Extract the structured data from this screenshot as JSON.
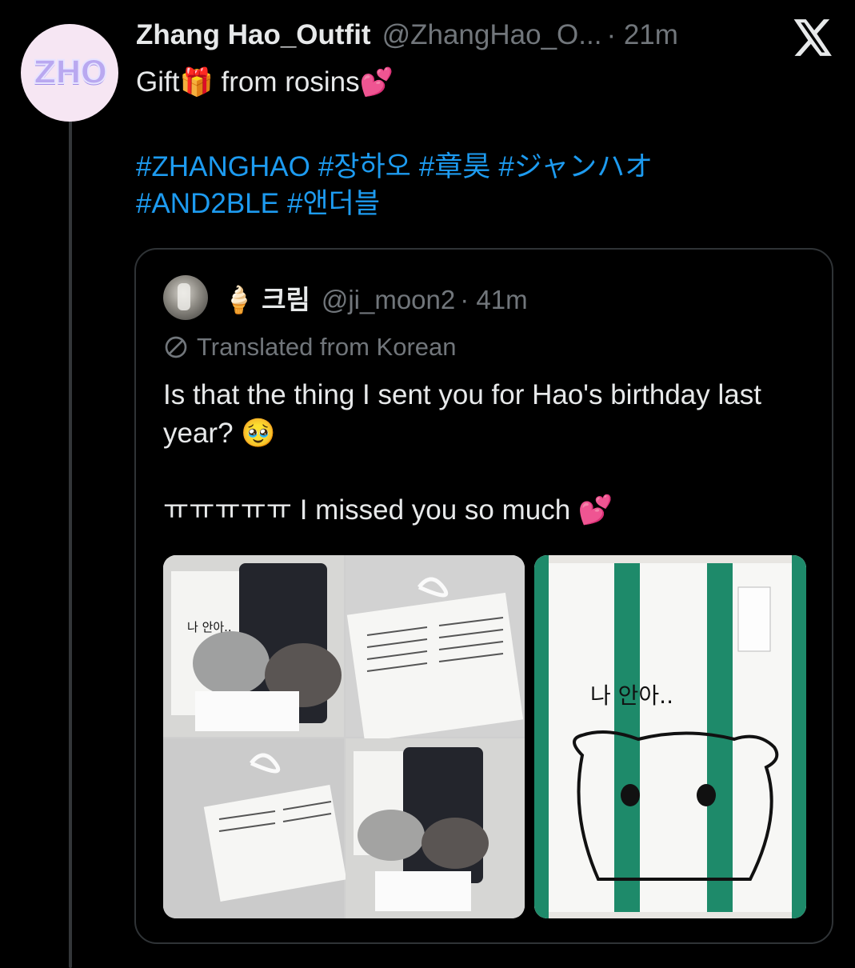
{
  "tweet": {
    "avatar_text": "ZHO",
    "display_name": "Zhang Hao_Outfit",
    "handle": "@ZhangHao_O...",
    "time": "· 21m",
    "text_before_emoji": "Gift",
    "gift_emoji": "🎁",
    "text_after_emoji": " from rosins",
    "heart_emoji": "💕",
    "hashtags": [
      "#ZHANGHAO",
      "#장하오",
      "#章昊",
      "#ジャンハオ",
      "#AND2BLE",
      "#앤더블"
    ]
  },
  "quote": {
    "name_emoji": "🍦",
    "display_name": "크림",
    "handle": "@ji_moon2",
    "time": "· 41m",
    "translated_label": "Translated from Korean",
    "text_line1": "Is that the thing I sent you for Hao's birthday last year? 🥹",
    "text_line2": "ㅠㅠㅠㅠㅠ I missed you so much 💕",
    "left_image_text_1": "나 안아..",
    "right_image_text": "나  안아..",
    "icons": [
      "globe-icon"
    ]
  },
  "colors": {
    "background": "#000000",
    "text": "#e7e9ea",
    "muted": "#71767b",
    "hashtag": "#1d9bf0",
    "border": "#2f3336",
    "tape_green": "#1e8a6a"
  }
}
